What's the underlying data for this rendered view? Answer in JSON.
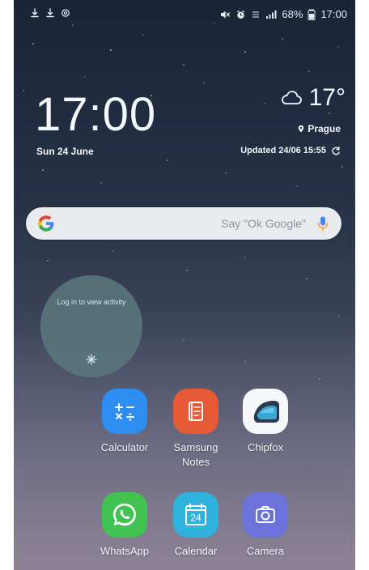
{
  "statusbar": {
    "battery_text": "68%",
    "time": "17:00"
  },
  "clock": {
    "time": "17:00",
    "date": "Sun 24 June"
  },
  "weather": {
    "temp": "17°",
    "location": "Prague",
    "updated": "Updated 24/06 15:55"
  },
  "search": {
    "placeholder": "Say \"Ok Google\""
  },
  "widget": {
    "text": "Log in to view activity"
  },
  "apps": [
    {
      "label": "Calculator",
      "icon": "calculator-icon"
    },
    {
      "label": "Samsung Notes",
      "icon": "samsung-notes-icon"
    },
    {
      "label": "Chipfox",
      "icon": "chipfox-icon"
    },
    {
      "label": "WhatsApp",
      "icon": "whatsapp-icon"
    },
    {
      "label": "Calendar",
      "icon": "calendar-icon",
      "day": "24"
    },
    {
      "label": "Camera",
      "icon": "camera-icon"
    }
  ],
  "colors": {
    "calculator": "#2d8df1",
    "samsung_notes": "#e65a35",
    "chipfox": "#f5f7fa",
    "whatsapp": "#40c351",
    "calendar": "#2fb2dd",
    "camera": "#6b72da",
    "google_blue": "#4285F4",
    "mic_orange": "#f4a640"
  }
}
